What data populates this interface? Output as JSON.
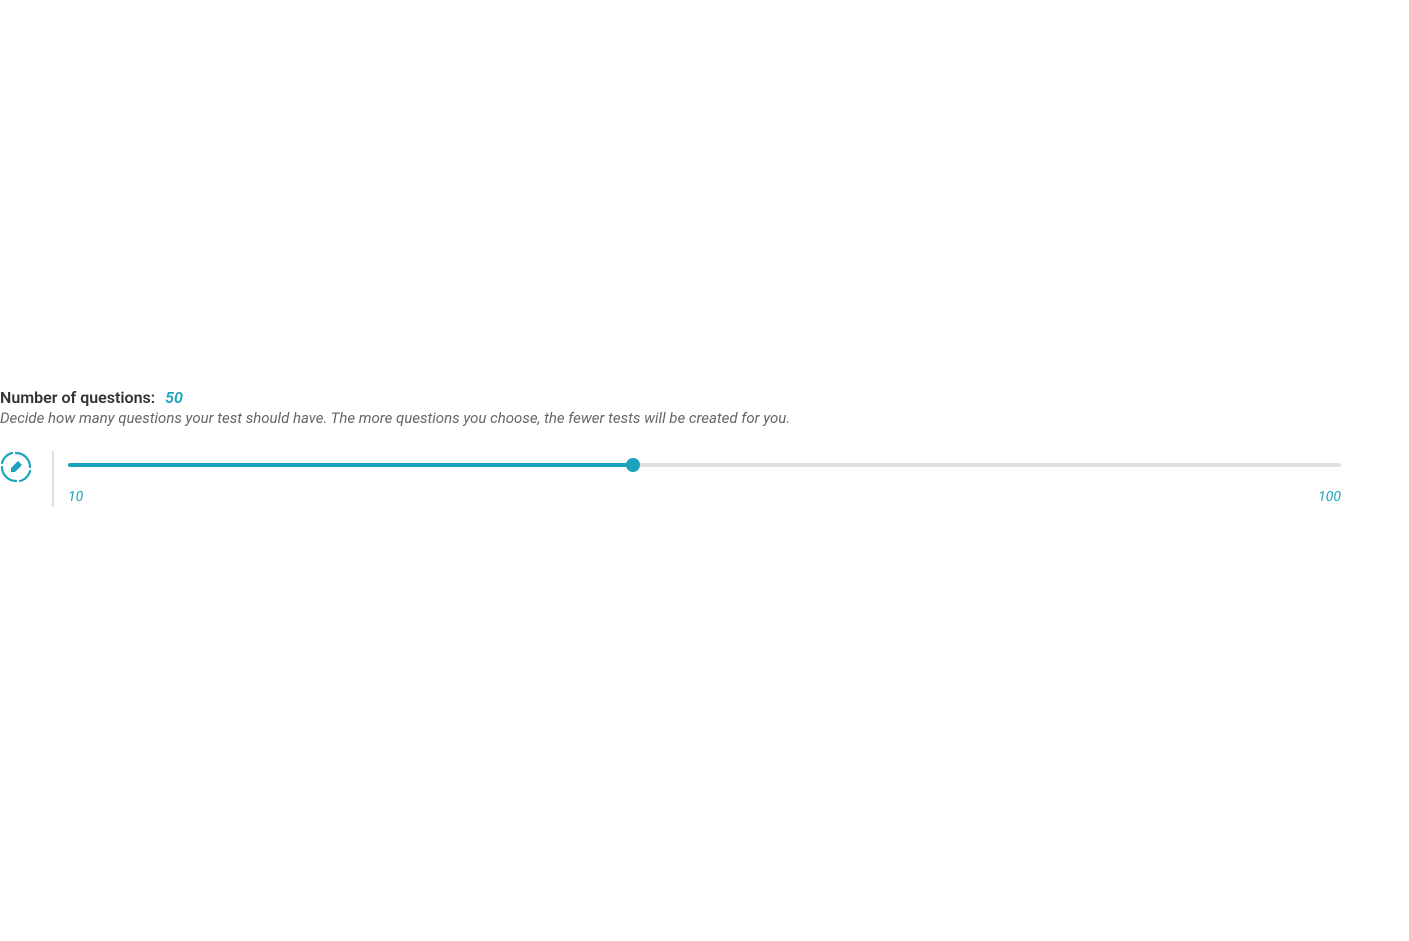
{
  "heading": {
    "label": "Number of questions:",
    "value": "50"
  },
  "description": "Decide how many questions your test should have. The more questions you choose, the fewer tests will be created for you.",
  "slider": {
    "min": 10,
    "max": 100,
    "value": 50,
    "min_label": "10",
    "max_label": "100",
    "fill_percent": "44.4%"
  },
  "colors": {
    "accent": "#1ba3bb",
    "text": "#333333",
    "muted": "#666666",
    "track": "#e0e0e0"
  }
}
